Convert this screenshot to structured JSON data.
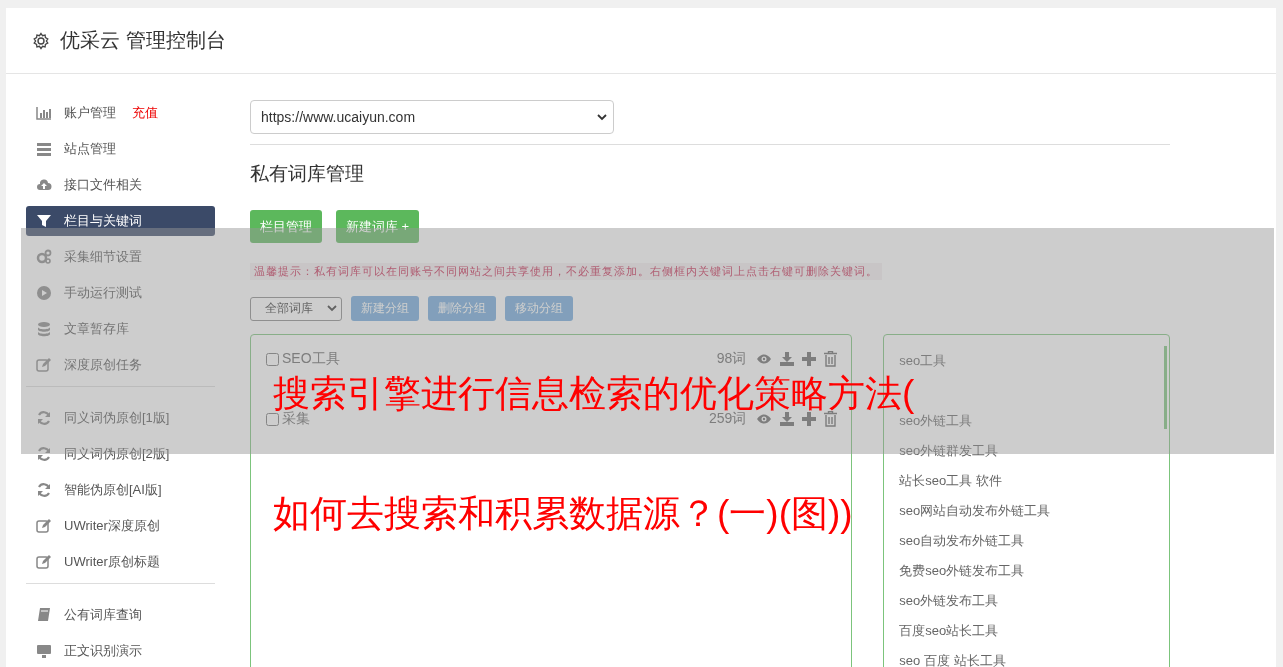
{
  "header": {
    "title": "优采云 管理控制台"
  },
  "sidebar": {
    "groups": [
      [
        {
          "label": "账户管理",
          "badge": "充值",
          "selected": false
        },
        {
          "label": "站点管理",
          "selected": false
        },
        {
          "label": "接口文件相关",
          "selected": false
        },
        {
          "label": "栏目与关键词",
          "selected": true
        },
        {
          "label": "采集细节设置",
          "selected": false
        },
        {
          "label": "手动运行测试",
          "selected": false
        },
        {
          "label": "文章暂存库",
          "selected": false
        },
        {
          "label": "深度原创任务",
          "selected": false
        }
      ],
      [
        {
          "label": "同义词伪原创[1版]",
          "selected": false
        },
        {
          "label": "同义词伪原创[2版]",
          "selected": false
        },
        {
          "label": "智能伪原创[AI版]",
          "selected": false
        },
        {
          "label": "UWriter深度原创",
          "selected": false
        },
        {
          "label": "UWriter原创标题",
          "selected": false
        }
      ],
      [
        {
          "label": "公有词库查询",
          "selected": false
        },
        {
          "label": "正文识别演示",
          "selected": false
        }
      ]
    ]
  },
  "site_select": {
    "value": "https://www.ucaiyun.com"
  },
  "section_title": "私有词库管理",
  "buttons": [
    "栏目管理",
    "新建词库 +"
  ],
  "tip": "温馨提示：私有词库可以在同账号不同网站之间共享使用，不必重复添加。右侧框内关键词上点击右键可删除关键词。",
  "group_select": {
    "value": "全部词库"
  },
  "group_buttons": [
    "新建分组",
    "删除分组",
    "移动分组"
  ],
  "libraries": [
    {
      "kind": "row",
      "name": "SEO工具",
      "count": "98词",
      "checked": false
    },
    {
      "kind": "row",
      "name": "采集",
      "count": "259词",
      "checked": false
    }
  ],
  "keywords": [
    {
      "text": "seo工具"
    },
    {
      "text": "seo外链工具"
    },
    {
      "text": "seo外链群发工具"
    },
    {
      "text": "站长seo工具 软件"
    },
    {
      "text": "seo网站自动发布外链工具"
    },
    {
      "text": "seo自动发布外链工具"
    },
    {
      "text": "免费seo外链发布工具"
    },
    {
      "text": "seo外链发布工具"
    },
    {
      "text": "百度seo站长工具"
    },
    {
      "text": "seo 百度 站长工具"
    }
  ],
  "overlay": {
    "title_lines": [
      "搜索引擎进行信息检索的优化策略方法(",
      "如何去搜索和积累数据源？(一)(图))"
    ]
  }
}
